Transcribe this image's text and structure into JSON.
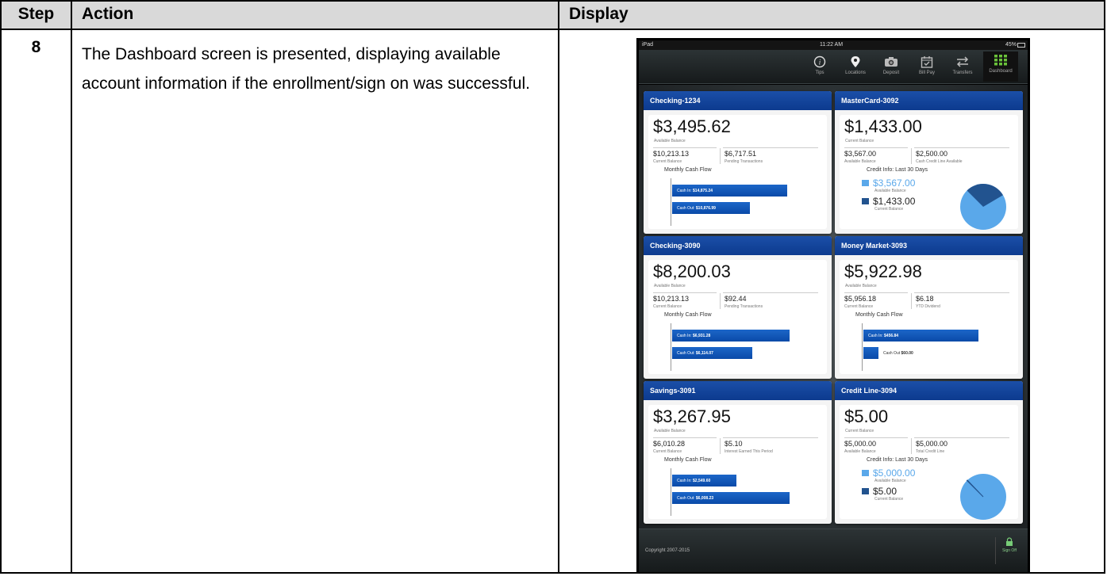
{
  "table": {
    "headers": [
      "Step",
      "Action",
      "Display"
    ],
    "rows": [
      {
        "step": "8",
        "action": "The Dashboard screen is presented, displaying available account information if the enrollment/sign on was successful."
      }
    ]
  },
  "ipad": {
    "status": {
      "device": "iPad",
      "time": "11:22 AM",
      "battery": "45%"
    },
    "toolbar": [
      {
        "icon": "info-icon",
        "label": "Tips"
      },
      {
        "icon": "location-pin-icon",
        "label": "Locations"
      },
      {
        "icon": "camera-icon",
        "label": "Deposit"
      },
      {
        "icon": "calendar-icon",
        "label": "Bill Pay"
      },
      {
        "icon": "transfer-arrows-icon",
        "label": "Transfers"
      },
      {
        "icon": "grid-icon",
        "label": "Dashboard"
      }
    ],
    "cards": [
      {
        "title": "Checking-1234",
        "balance": "$3,495.62",
        "balance_label": "Available Balance",
        "sub1": "$10,213.13",
        "sub1_label": "Current Balance",
        "sub2": "$6,717.51",
        "sub2_label": "Pending Transactions",
        "flow_title": "Monthly Cash Flow",
        "cash_in_label": "Cash In",
        "cash_in": "$14,875.24",
        "cash_in_fraction": 0.98,
        "cash_out_label": "Cash Out",
        "cash_out": "$10,876.99",
        "cash_out_fraction": 0.66
      },
      {
        "title": "MasterCard-3092",
        "balance": "$1,433.00",
        "balance_label": "Current Balance",
        "sub1": "$3,567.00",
        "sub1_label": "Available Balance",
        "sub2": "$2,500.00",
        "sub2_label": "Cash Credit Line Available",
        "credit_title": "Credit Info: Last 30 Days",
        "legend1_value": "$3,567.00",
        "legend1_label": "Available Balance",
        "legend2_value": "$1,433.00",
        "legend2_label": "Current Balance",
        "pie_fraction": 0.29
      },
      {
        "title": "Checking-3090",
        "balance": "$8,200.03",
        "balance_label": "Available Balance",
        "sub1": "$10,213.13",
        "sub1_label": "Current Balance",
        "sub2": "$92.44",
        "sub2_label": "Pending Transactions",
        "flow_title": "Monthly Cash Flow",
        "cash_in_label": "Cash In",
        "cash_in": "$6,931.28",
        "cash_in_fraction": 1.0,
        "cash_out_label": "Cash Out",
        "cash_out": "$6,114.07",
        "cash_out_fraction": 0.68
      },
      {
        "title": "Money Market-3093",
        "balance": "$5,922.98",
        "balance_label": "Available Balance",
        "sub1": "$5,956.18",
        "sub1_label": "Current Balance",
        "sub2": "$6.18",
        "sub2_label": "YTD Dividend",
        "flow_title": "Monthly Cash Flow",
        "cash_in_label": "Cash In",
        "cash_in": "$456.84",
        "cash_in_fraction": 0.98,
        "cash_out_label": "Cash Out",
        "cash_out": "$60.00",
        "cash_out_fraction": 0.13
      },
      {
        "title": "Savings-3091",
        "balance": "$3,267.95",
        "balance_label": "Available Balance",
        "sub1": "$6,010.28",
        "sub1_label": "Current Balance",
        "sub2": "$5.10",
        "sub2_label": "Interest Earned This Period",
        "flow_title": "Monthly Cash Flow",
        "cash_in_label": "Cash In",
        "cash_in": "$2,549.60",
        "cash_in_fraction": 0.55,
        "cash_out_label": "Cash Out",
        "cash_out": "$6,008.23",
        "cash_out_fraction": 1.0
      },
      {
        "title": "Credit Line-3094",
        "balance": "$5.00",
        "balance_label": "Current Balance",
        "sub1": "$5,000.00",
        "sub1_label": "Available Balance",
        "sub2": "$5,000.00",
        "sub2_label": "Total Credit Line",
        "credit_title": "Credit Info: Last 30 Days",
        "legend1_value": "$5,000.00",
        "legend1_label": "Available Balance",
        "legend2_value": "$5.00",
        "legend2_label": "Current Balance",
        "pie_fraction": 0.001
      }
    ],
    "footer": {
      "copyright": "Copyright 2007-2015",
      "signoff": "Sign Off"
    },
    "colors": {
      "header_blue": "#0c3a8e",
      "bar_blue": "#1c66c8",
      "pie_light": "#5aa8ea",
      "pie_dark": "#22538f"
    }
  }
}
